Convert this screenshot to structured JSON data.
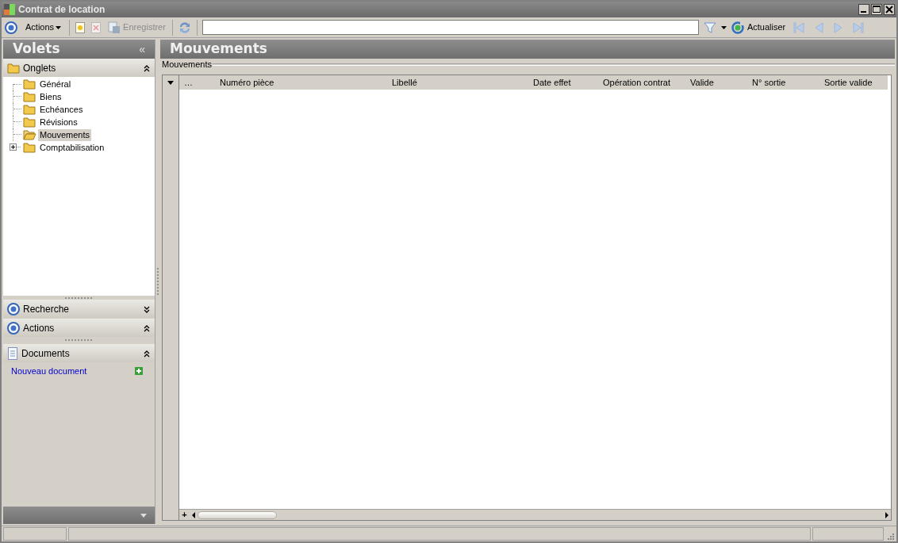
{
  "window": {
    "title": "Contrat de location"
  },
  "toolbar": {
    "actions_menu": "Actions",
    "new_disabled": false,
    "delete_disabled": true,
    "save": {
      "label": "Enregistrer",
      "disabled": true
    },
    "refresh_label": "Actualiser",
    "nav": [
      {
        "kind": "first",
        "disabled": true
      },
      {
        "kind": "prev",
        "disabled": true
      },
      {
        "kind": "next",
        "disabled": true
      },
      {
        "kind": "last",
        "disabled": true
      }
    ]
  },
  "sidebar": {
    "title": "Volets",
    "collapse_glyph": "«",
    "sections": [
      {
        "kind": "tree",
        "title": "Onglets",
        "expanded": true,
        "items": [
          {
            "label": "Général",
            "selected": false
          },
          {
            "label": "Biens",
            "selected": false
          },
          {
            "label": "Echéances",
            "selected": false
          },
          {
            "label": "Révisions",
            "selected": false
          },
          {
            "label": "Mouvements",
            "selected": true
          },
          {
            "label": "Comptabilisation",
            "selected": false,
            "expanded": false
          }
        ]
      },
      {
        "kind": "search",
        "title": "Recherche",
        "expanded": false
      },
      {
        "kind": "actions",
        "title": "Actions",
        "expanded": true
      },
      {
        "kind": "documents",
        "title": "Documents",
        "expanded": true,
        "links": [
          "Nouveau document"
        ]
      }
    ]
  },
  "main": {
    "title": "Mouvements",
    "group_label": "Mouvements",
    "grid": {
      "add_row_glyph": "+",
      "columns": [
        "…",
        "Numéro pièce",
        "Libellé",
        "Date effet",
        "Opération contrat",
        "Valide",
        "N° sortie",
        "Sortie valide"
      ]
    }
  }
}
